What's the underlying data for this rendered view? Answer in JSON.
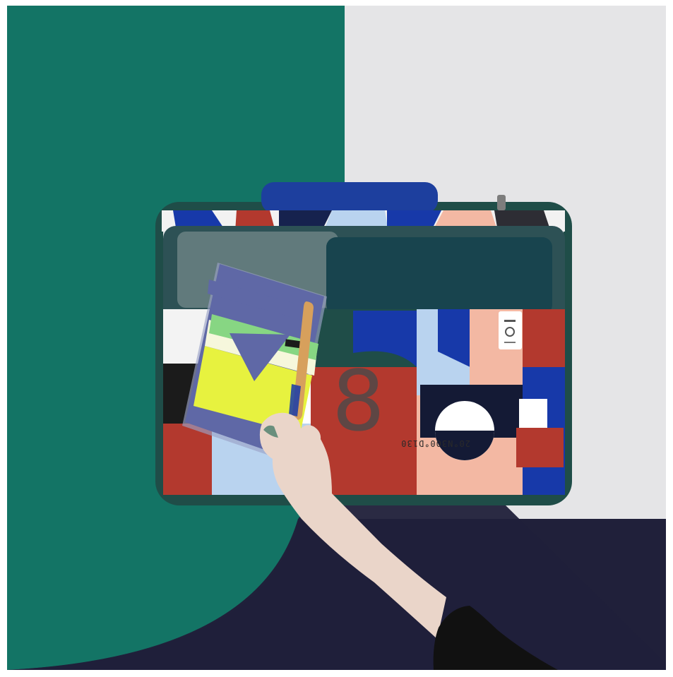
{
  "scene": {
    "colors": {
      "teal": "#137465",
      "light_gray": "#e5e5e7",
      "navy": "#20203a",
      "bag_dark_green": "#1f4d48",
      "bag_blue": "#1739a9",
      "bag_red": "#b3392e",
      "bag_peach": "#f3b8a3",
      "bag_light_blue": "#b9d3ef",
      "notebook_purple": "#5f68a6",
      "notebook_yellow": "#e7f23f",
      "notebook_green": "#87d683"
    }
  },
  "bag": {
    "number_print": "8",
    "coordinates_print": "20°N300°D130"
  },
  "icons": {
    "tag": "brand-tag-icon"
  }
}
